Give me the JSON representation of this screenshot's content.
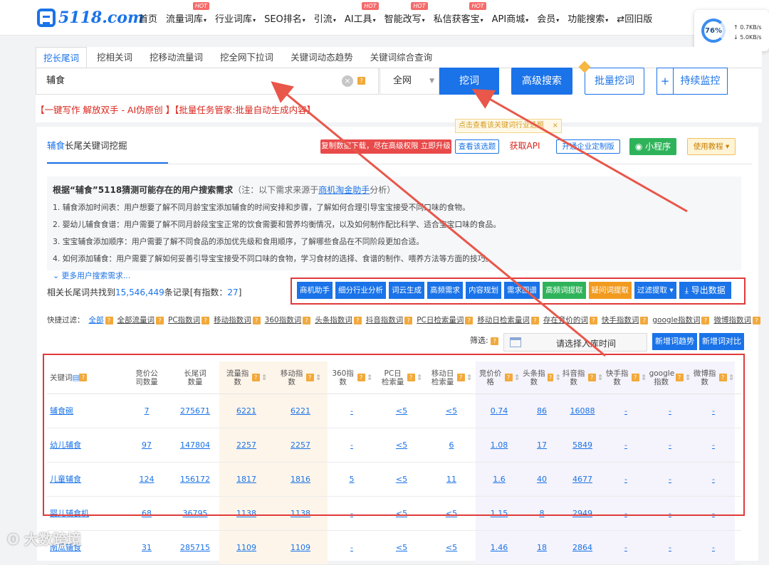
{
  "logo": {
    "text": "5118.com"
  },
  "nav": {
    "items": [
      {
        "label": "首页",
        "hot": ""
      },
      {
        "label": "流量词库",
        "hot": "HOT",
        "caret": "▾"
      },
      {
        "label": "行业词库",
        "hot": "",
        "caret": "▾"
      },
      {
        "label": "SEO排名",
        "hot": "",
        "caret": "▾"
      },
      {
        "label": "引流",
        "hot": "",
        "caret": "▾"
      },
      {
        "label": "AI工具",
        "hot": "HOT",
        "caret": "▾"
      },
      {
        "label": "智能改写",
        "hot": "HOT",
        "caret": "▾"
      },
      {
        "label": "私信获客宝",
        "hot": "HOT",
        "caret": "▾"
      },
      {
        "label": "API商城",
        "hot": "",
        "caret": "▾"
      },
      {
        "label": "会员",
        "hot": "",
        "caret": "▾"
      },
      {
        "label": "功能搜索",
        "hot": "",
        "caret": "▾"
      },
      {
        "label": "⇄回旧版",
        "hot": ""
      }
    ]
  },
  "net_widget": {
    "percent": "76%",
    "up": "0.7KB/s",
    "down": "5.0KB/s"
  },
  "tabs": [
    "挖长尾词",
    "挖相关词",
    "挖移动流量词",
    "挖全网下拉词",
    "关键词动态趋势",
    "关键词综合查询"
  ],
  "search": {
    "value": "辅食",
    "scope": "全网",
    "dig": "挖词",
    "advanced": "高级搜索",
    "batch": "批量挖词",
    "plus": "+",
    "monitor": "持续监控"
  },
  "promo": "【一键写作 解放双手 - AI伪原创 】【批量任务管家:批量自动生成内容】",
  "card": {
    "title_kw": "辅食",
    "title_rest": "长尾关键词挖掘",
    "tooltip": "点击查看该关键词行业选题",
    "btn_download": "复制数据下载，尽在高级权限 立即升级",
    "btn_view": "查看该选题",
    "btn_api": "获取API",
    "btn_enterprise": "开通企业定制版",
    "btn_mini": "小程序",
    "btn_guide": "使用教程 ▾"
  },
  "needs": {
    "title": "根据“辅食”5118猜测可能存在的用户搜索需求",
    "note_prefix": "（注：以下需求来源于",
    "note_link": "商机淘金助手",
    "note_suffix": "分析）",
    "lines": [
      "1. 辅食添加时间表：用户想要了解不同月龄宝宝添加辅食的时间安排和步骤，了解如何合理引导宝宝接受不同口味的食物。",
      "2. 婴幼儿辅食食谱：用户需要了解不同月龄段宝宝正常的饮食需要和营养均衡情况，以及如何制作配比科学、适合宝宝口味的食品。",
      "3. 宝宝辅食添加顺序：用户需要了解不同食品的添加优先级和食用顺序，了解哪些食品在不同阶段更加合适。",
      "4. 如何添加辅食：用户需要了解如何妥善引导宝宝接受不同口味的食物，学习食材的选择、食谱的制作、喂养方法等方面的技巧。"
    ],
    "more": "更多用户搜索需求..."
  },
  "count": {
    "prefix": "相关长尾词共找到",
    "total": "15,546,449",
    "mid": "条记录[有指数：",
    "indexed": "27",
    "suffix": "]"
  },
  "tools": [
    "商机助手",
    "细分行业分析",
    "词云生成",
    "高频需求",
    "内容规划",
    "需求图谱",
    "高频词提取",
    "疑问词提取",
    "过滤提取 ▾",
    "导出数据"
  ],
  "filters": {
    "label": "快捷过滤：",
    "items": [
      "全部",
      "全部流量词",
      "PC指数词",
      "移动指数词",
      "360指数词",
      "头条指数词",
      "抖音指数词",
      "PC日检索量词",
      "移动日检索量词",
      "存在竞价的词",
      "快手指数词",
      "google指数词",
      "微博指数词"
    ]
  },
  "select": {
    "label": "筛选:",
    "date": "请选择入库时间",
    "btn_trend": "新增词趋势",
    "btn_compare": "新增词对比"
  },
  "table": {
    "headers": [
      "关键词",
      "竞价公司数量",
      "长尾词数量",
      "流量指数",
      "移动指数",
      "360指数",
      "PC日检索量",
      "移动日检索量",
      "竞价价格",
      "头条指数",
      "抖音指数",
      "快手指数",
      "google指数",
      "微博指数"
    ],
    "rows": [
      [
        "辅食碗",
        "7",
        "275671",
        "6221",
        "6221",
        "-",
        "<5",
        "<5",
        "0.74",
        "86",
        "16088",
        "-",
        "-",
        "-"
      ],
      [
        "幼儿辅食",
        "97",
        "147804",
        "2257",
        "2257",
        "-",
        "<5",
        "6",
        "1.08",
        "17",
        "5849",
        "-",
        "-",
        "-"
      ],
      [
        "儿童辅食",
        "124",
        "156172",
        "1817",
        "1816",
        "5",
        "<5",
        "11",
        "1.6",
        "40",
        "4677",
        "-",
        "-",
        "-"
      ],
      [
        "婴儿辅食机",
        "68",
        "36795",
        "1138",
        "1138",
        "-",
        "<5",
        "<5",
        "1.15",
        "8",
        "2949",
        "-",
        "-",
        "-"
      ],
      [
        "南瓜辅食",
        "31",
        "285715",
        "1109",
        "1109",
        "-",
        "<5",
        "<5",
        "1.46",
        "18",
        "2864",
        "-",
        "-",
        "-"
      ]
    ]
  },
  "watermark": "大数跨境"
}
